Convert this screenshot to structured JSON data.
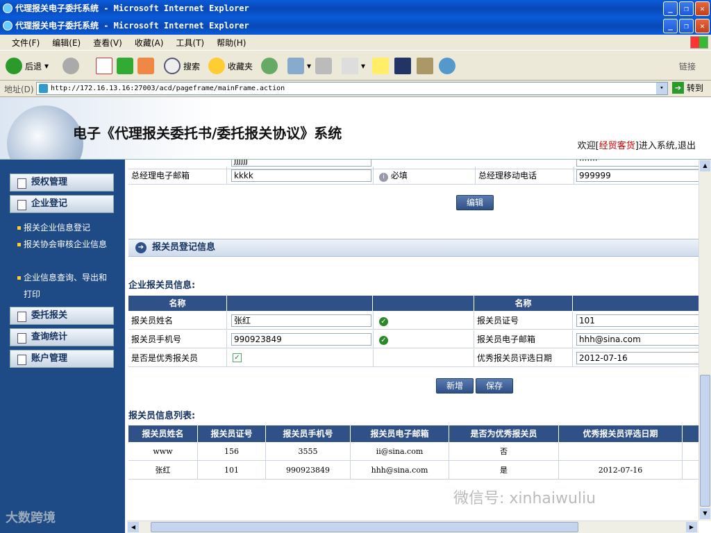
{
  "window": {
    "title": "代理报关电子委托系统 - Microsoft Internet Explorer",
    "title2": "代理报关电子委托系统 - Microsoft Internet Explorer"
  },
  "menu": [
    "文件(F)",
    "编辑(E)",
    "查看(V)",
    "收藏(A)",
    "工具(T)",
    "帮助(H)"
  ],
  "toolbar": {
    "back": "后退",
    "search": "搜索",
    "favorites": "收藏夹",
    "links": "链接"
  },
  "address": {
    "label": "地址(D)",
    "url": "http://172.16.13.16:27003/acd/pageframe/mainFrame.action",
    "go": "转到"
  },
  "header": {
    "system_name": "电子《代理报关委托书/委托报关协议》系统",
    "welcome_prefix": "欢迎[",
    "user": "经贸客货",
    "welcome_suffix": "]进入系统,",
    "logout": "退出"
  },
  "sidebar": {
    "items": [
      "授权管理",
      "企业登记",
      "委托报关",
      "查询统计",
      "账户管理"
    ],
    "subitems": [
      "报关企业信息登记",
      "报关协会审核企业信息",
      "企业信息查询、导出和打印"
    ]
  },
  "form_top": {
    "partial_value": "jjjjjj",
    "partial_value2": "·······",
    "gm_email_label": "总经理电子邮箱",
    "gm_email_value": "kkkk",
    "required": "必填",
    "gm_mobile_label": "总经理移动电话",
    "gm_mobile_value": "999999",
    "edit_button": "编辑"
  },
  "section_title": "报关员登记信息",
  "broker_form": {
    "heading": "企业报关员信息:",
    "col_name": "名称",
    "col_name2": "名称",
    "name_label": "报关员姓名",
    "name_value": "张红",
    "cert_label": "报关员证号",
    "cert_value": "101",
    "mobile_label": "报关员手机号",
    "mobile_value": "990923849",
    "email_label": "报关员电子邮箱",
    "email_value": "hhh@sina.com",
    "excellent_label": "是否是优秀报关员",
    "excellent_date_label": "优秀报关员评选日期",
    "excellent_date_value": "2012-07-16",
    "add_button": "新增",
    "save_button": "保存"
  },
  "broker_list": {
    "heading": "报关员信息列表:",
    "columns": [
      "报关员姓名",
      "报关员证号",
      "报关员手机号",
      "报关员电子邮箱",
      "是否为优秀报关员",
      "优秀报关员评选日期"
    ],
    "rows": [
      [
        "www",
        "156",
        "3555",
        "ii@sina.com",
        "否",
        ""
      ],
      [
        "张红",
        "101",
        "990923849",
        "hhh@sina.com",
        "是",
        "2012-07-16"
      ]
    ]
  },
  "watermarks": {
    "left": "大数跨境",
    "right": "微信号: xinhaiwuliu"
  }
}
